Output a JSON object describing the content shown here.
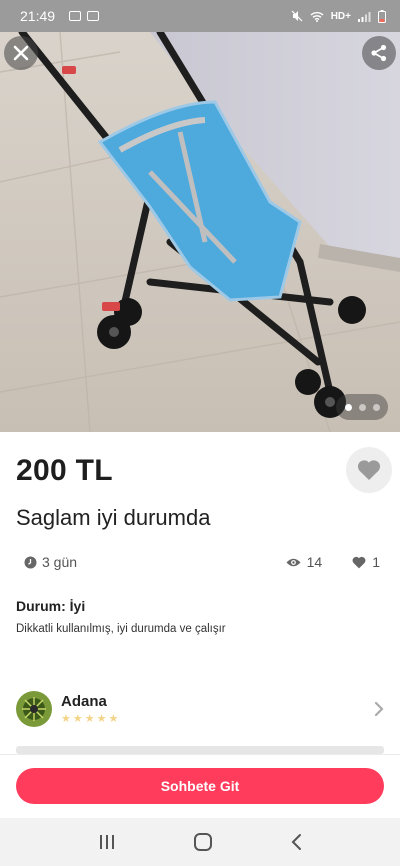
{
  "status_bar": {
    "time": "21:49",
    "network_label": "HD+"
  },
  "listing": {
    "price": "200 TL",
    "title": "Saglam iyi durumda",
    "posted_ago": "3 gün",
    "views": "14",
    "favorites": "1",
    "condition_label": "Durum: İyi",
    "description": "Dikkatli kullanılmış, iyi durumda ve çalışır"
  },
  "seller": {
    "name": "Adana",
    "rating_stars": 5
  },
  "gallery": {
    "image_count": 3,
    "active_index": 0
  },
  "actions": {
    "chat_label": "Sohbete Git"
  },
  "colors": {
    "accent": "#ff3c5c",
    "star": "#f4d488",
    "status_bar": "#9b9b9b"
  },
  "icons": [
    "close-icon",
    "share-icon",
    "heart-icon",
    "clock-icon",
    "eye-icon",
    "chevron-right-icon",
    "recents-icon",
    "home-icon",
    "back-icon"
  ]
}
